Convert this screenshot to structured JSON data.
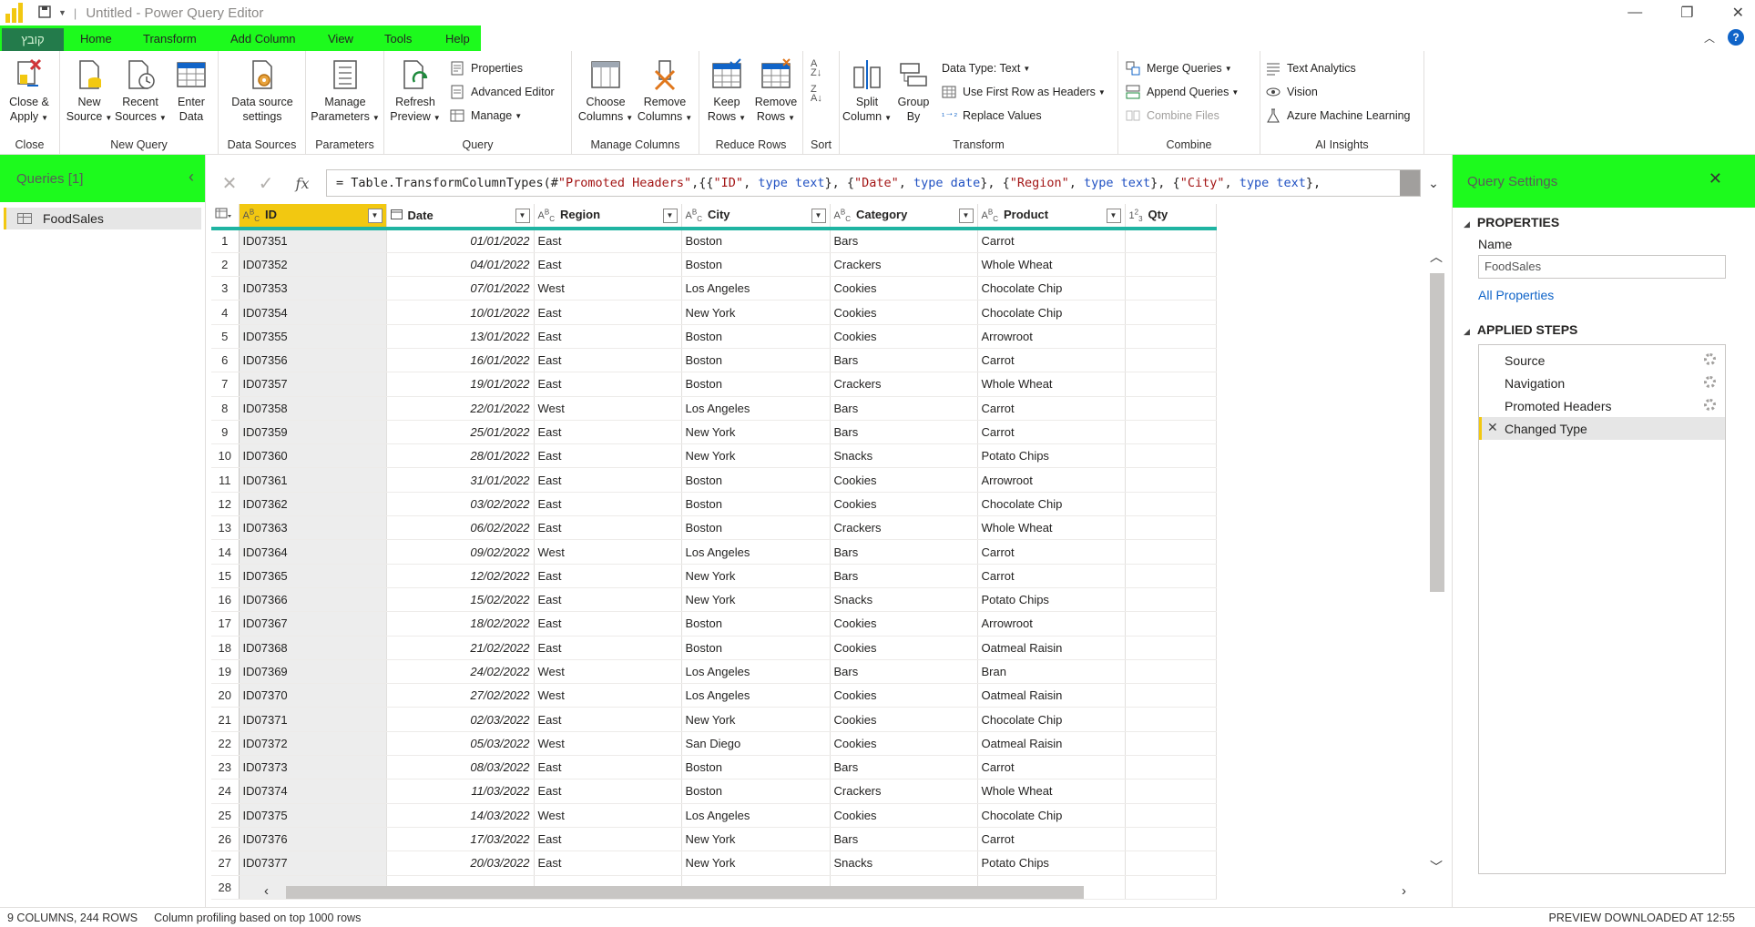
{
  "window": {
    "title": "Untitled - Power Query Editor"
  },
  "tabs": {
    "file": "קובץ",
    "items": [
      "Home",
      "Transform",
      "Add Column",
      "View",
      "Tools",
      "Help"
    ]
  },
  "ribbon": {
    "close": {
      "label1": "Close &",
      "label2": "Apply",
      "group": "Close"
    },
    "new_query": {
      "new_source1": "New",
      "new_source2": "Source",
      "recent1": "Recent",
      "recent2": "Sources",
      "enter1": "Enter",
      "enter2": "Data",
      "group": "New Query"
    },
    "data_sources": {
      "label1": "Data source",
      "label2": "settings",
      "group": "Data Sources"
    },
    "parameters": {
      "label1": "Manage",
      "label2": "Parameters",
      "group": "Parameters"
    },
    "query": {
      "refresh1": "Refresh",
      "refresh2": "Preview",
      "properties": "Properties",
      "advanced": "Advanced Editor",
      "manage": "Manage",
      "group": "Query"
    },
    "manage_columns": {
      "choose1": "Choose",
      "choose2": "Columns",
      "remove1": "Remove",
      "remove2": "Columns",
      "group": "Manage Columns"
    },
    "reduce_rows": {
      "keep1": "Keep",
      "keep2": "Rows",
      "remove1": "Remove",
      "remove2": "Rows",
      "group": "Reduce Rows"
    },
    "sort": {
      "group": "Sort"
    },
    "transform": {
      "split1": "Split",
      "split2": "Column",
      "group_by1": "Group",
      "group_by2": "By",
      "data_type": "Data Type: Text",
      "first_row": "Use First Row as Headers",
      "replace": "Replace Values",
      "group": "Transform"
    },
    "combine": {
      "merge": "Merge Queries",
      "append": "Append Queries",
      "combine_files": "Combine Files",
      "group": "Combine"
    },
    "ai": {
      "text": "Text Analytics",
      "vision": "Vision",
      "aml": "Azure Machine Learning",
      "group": "AI Insights"
    }
  },
  "queries_pane": {
    "title": "Queries [1]",
    "items": [
      "FoodSales"
    ]
  },
  "formula": {
    "prefix": "= Table.TransformColumnTypes(#",
    "tokens": [
      {
        "t": "\"Promoted Headers\"",
        "c": "str"
      },
      {
        "t": ",{{",
        "c": ""
      },
      {
        "t": "\"ID\"",
        "c": "str"
      },
      {
        "t": ", ",
        "c": ""
      },
      {
        "t": "type text",
        "c": "kw"
      },
      {
        "t": "}, {",
        "c": ""
      },
      {
        "t": "\"Date\"",
        "c": "str"
      },
      {
        "t": ", ",
        "c": ""
      },
      {
        "t": "type date",
        "c": "kw"
      },
      {
        "t": "}, {",
        "c": ""
      },
      {
        "t": "\"Region\"",
        "c": "str"
      },
      {
        "t": ", ",
        "c": ""
      },
      {
        "t": "type text",
        "c": "kw"
      },
      {
        "t": "}, {",
        "c": ""
      },
      {
        "t": "\"City\"",
        "c": "str"
      },
      {
        "t": ", ",
        "c": ""
      },
      {
        "t": "type text",
        "c": "kw"
      },
      {
        "t": "},",
        "c": ""
      }
    ]
  },
  "grid": {
    "columns": [
      {
        "name": "ID",
        "type": "ABC"
      },
      {
        "name": "Date",
        "type": "date"
      },
      {
        "name": "Region",
        "type": "ABC"
      },
      {
        "name": "City",
        "type": "ABC"
      },
      {
        "name": "Category",
        "type": "ABC"
      },
      {
        "name": "Product",
        "type": "ABC"
      },
      {
        "name": "Qty",
        "type": "123"
      }
    ],
    "rows": [
      [
        "ID07351",
        "01/01/2022",
        "East",
        "Boston",
        "Bars",
        "Carrot"
      ],
      [
        "ID07352",
        "04/01/2022",
        "East",
        "Boston",
        "Crackers",
        "Whole Wheat"
      ],
      [
        "ID07353",
        "07/01/2022",
        "West",
        "Los Angeles",
        "Cookies",
        "Chocolate Chip"
      ],
      [
        "ID07354",
        "10/01/2022",
        "East",
        "New York",
        "Cookies",
        "Chocolate Chip"
      ],
      [
        "ID07355",
        "13/01/2022",
        "East",
        "Boston",
        "Cookies",
        "Arrowroot"
      ],
      [
        "ID07356",
        "16/01/2022",
        "East",
        "Boston",
        "Bars",
        "Carrot"
      ],
      [
        "ID07357",
        "19/01/2022",
        "East",
        "Boston",
        "Crackers",
        "Whole Wheat"
      ],
      [
        "ID07358",
        "22/01/2022",
        "West",
        "Los Angeles",
        "Bars",
        "Carrot"
      ],
      [
        "ID07359",
        "25/01/2022",
        "East",
        "New York",
        "Bars",
        "Carrot"
      ],
      [
        "ID07360",
        "28/01/2022",
        "East",
        "New York",
        "Snacks",
        "Potato Chips"
      ],
      [
        "ID07361",
        "31/01/2022",
        "East",
        "Boston",
        "Cookies",
        "Arrowroot"
      ],
      [
        "ID07362",
        "03/02/2022",
        "East",
        "Boston",
        "Cookies",
        "Chocolate Chip"
      ],
      [
        "ID07363",
        "06/02/2022",
        "East",
        "Boston",
        "Crackers",
        "Whole Wheat"
      ],
      [
        "ID07364",
        "09/02/2022",
        "West",
        "Los Angeles",
        "Bars",
        "Carrot"
      ],
      [
        "ID07365",
        "12/02/2022",
        "East",
        "New York",
        "Bars",
        "Carrot"
      ],
      [
        "ID07366",
        "15/02/2022",
        "East",
        "New York",
        "Snacks",
        "Potato Chips"
      ],
      [
        "ID07367",
        "18/02/2022",
        "East",
        "Boston",
        "Cookies",
        "Arrowroot"
      ],
      [
        "ID07368",
        "21/02/2022",
        "East",
        "Boston",
        "Cookies",
        "Oatmeal Raisin"
      ],
      [
        "ID07369",
        "24/02/2022",
        "West",
        "Los Angeles",
        "Bars",
        "Bran"
      ],
      [
        "ID07370",
        "27/02/2022",
        "West",
        "Los Angeles",
        "Cookies",
        "Oatmeal Raisin"
      ],
      [
        "ID07371",
        "02/03/2022",
        "East",
        "New York",
        "Cookies",
        "Chocolate Chip"
      ],
      [
        "ID07372",
        "05/03/2022",
        "West",
        "San Diego",
        "Cookies",
        "Oatmeal Raisin"
      ],
      [
        "ID07373",
        "08/03/2022",
        "East",
        "Boston",
        "Bars",
        "Carrot"
      ],
      [
        "ID07374",
        "11/03/2022",
        "East",
        "Boston",
        "Crackers",
        "Whole Wheat"
      ],
      [
        "ID07375",
        "14/03/2022",
        "West",
        "Los Angeles",
        "Cookies",
        "Chocolate Chip"
      ],
      [
        "ID07376",
        "17/03/2022",
        "East",
        "New York",
        "Bars",
        "Carrot"
      ],
      [
        "ID07377",
        "20/03/2022",
        "East",
        "New York",
        "Snacks",
        "Potato Chips"
      ],
      [
        "",
        "",
        "",
        "",
        "",
        ""
      ]
    ]
  },
  "settings_pane": {
    "title": "Query Settings",
    "properties_title": "PROPERTIES",
    "name_label": "Name",
    "name_value": "FoodSales",
    "all_properties": "All Properties",
    "steps_title": "APPLIED STEPS",
    "steps": [
      {
        "label": "Source",
        "gear": true
      },
      {
        "label": "Navigation",
        "gear": true
      },
      {
        "label": "Promoted Headers",
        "gear": true
      },
      {
        "label": "Changed Type",
        "gear": false,
        "active": true
      }
    ]
  },
  "status": {
    "columns_rows": "9 COLUMNS, 244 ROWS",
    "profiling": "Column profiling based on top 1000 rows",
    "preview": "PREVIEW DOWNLOADED AT 12:55"
  },
  "colors": {
    "accent_green": "#1dfa1d",
    "file_tab": "#237b4b",
    "selected_header": "#f2c811",
    "header_underline": "#1fb4a2",
    "link": "#1064c8"
  }
}
